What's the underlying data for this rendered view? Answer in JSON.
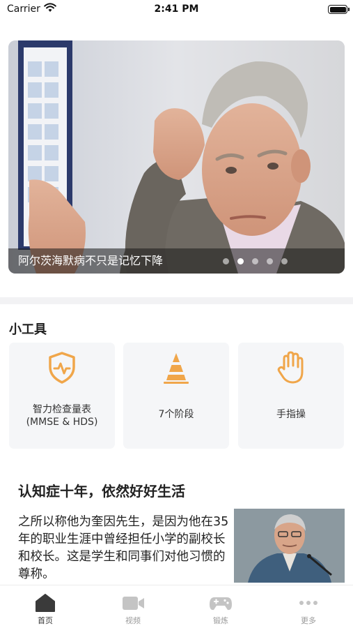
{
  "status_bar": {
    "carrier": "Carrier",
    "time": "2:41 PM"
  },
  "banner": {
    "caption": "阿尔茨海默病不只是记忆下降",
    "page_count": 5,
    "active_page": 2
  },
  "tools": {
    "title": "小工具",
    "items": [
      {
        "label_line1": "智力检查量表",
        "label_line2": "(MMSE & HDS)",
        "icon": "shield-pulse-icon"
      },
      {
        "label_line1": "7个阶段",
        "label_line2": "",
        "icon": "cone-stages-icon"
      },
      {
        "label_line1": "手指操",
        "label_line2": "",
        "icon": "hand-icon"
      }
    ]
  },
  "article": {
    "title": "认知症十年，依然好好生活",
    "body": "之所以称他为奎因先生，是因为他在35年的职业生涯中曾经担任小学的副校长和校长。这是学生和同事们对他习惯的尊称。"
  },
  "tab_bar": {
    "tabs": [
      {
        "label": "首页",
        "icon": "home-icon",
        "active": true
      },
      {
        "label": "视频",
        "icon": "video-camera-icon",
        "active": false
      },
      {
        "label": "锻炼",
        "icon": "gamepad-icon",
        "active": false
      },
      {
        "label": "更多",
        "icon": "more-dots-icon",
        "active": false
      }
    ]
  },
  "colors": {
    "accent_orange": "#F0A64A",
    "card_bg": "#F5F6F8",
    "divider": "#F2F2F4",
    "tab_active": "#333333",
    "tab_inactive": "#9A9A9A"
  }
}
